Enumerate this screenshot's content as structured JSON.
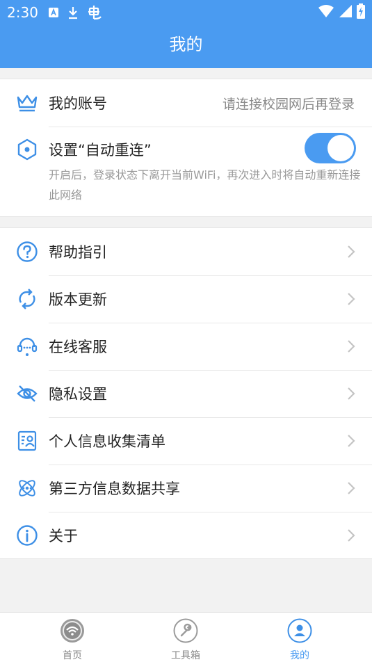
{
  "status_bar": {
    "time": "2:30"
  },
  "header": {
    "title": "我的"
  },
  "account": {
    "label": "我的账号",
    "status": "请连接校园网后再登录"
  },
  "auto_reconnect": {
    "label": "设置“自动重连”",
    "description": "开启后，登录状态下离开当前WiFi，再次进入时将自动重新连接此网络",
    "enabled": true
  },
  "menu": {
    "items": [
      {
        "label": "帮助指引"
      },
      {
        "label": "版本更新"
      },
      {
        "label": "在线客服"
      },
      {
        "label": "隐私设置"
      },
      {
        "label": "个人信息收集清单"
      },
      {
        "label": "第三方信息数据共享"
      },
      {
        "label": "关于"
      }
    ]
  },
  "tabs": [
    {
      "label": "首页"
    },
    {
      "label": "工具箱"
    },
    {
      "label": "我的"
    }
  ],
  "colors": {
    "accent": "#4a9bf1",
    "icon_blue": "#3d8fe6",
    "inactive_tab": "#888888"
  }
}
